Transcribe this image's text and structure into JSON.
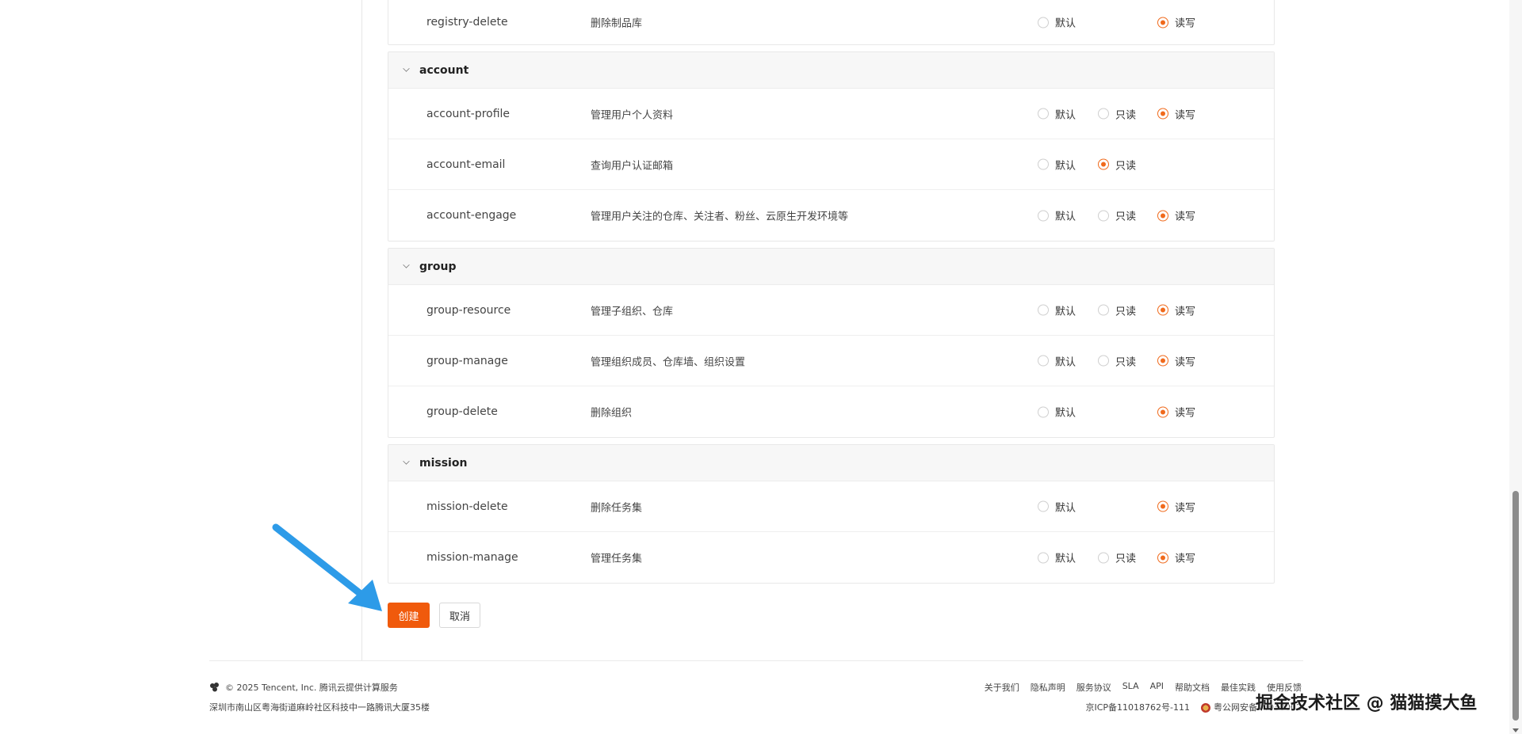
{
  "permission_groups": [
    {
      "name": "",
      "continued": true,
      "rows": [
        {
          "name": "registry-delete",
          "desc": "删除制品库",
          "options": [
            "default",
            "write"
          ],
          "selected": "write"
        }
      ]
    },
    {
      "name": "account",
      "rows": [
        {
          "name": "account-profile",
          "desc": "管理用户个人资料",
          "options": [
            "default",
            "read",
            "write"
          ],
          "selected": "write"
        },
        {
          "name": "account-email",
          "desc": "查询用户认证邮箱",
          "options": [
            "default",
            "read"
          ],
          "selected": "read"
        },
        {
          "name": "account-engage",
          "desc": "管理用户关注的仓库、关注者、粉丝、云原生开发环境等",
          "options": [
            "default",
            "read",
            "write"
          ],
          "selected": "write"
        }
      ]
    },
    {
      "name": "group",
      "rows": [
        {
          "name": "group-resource",
          "desc": "管理子组织、仓库",
          "options": [
            "default",
            "read",
            "write"
          ],
          "selected": "write"
        },
        {
          "name": "group-manage",
          "desc": "管理组织成员、仓库墙、组织设置",
          "options": [
            "default",
            "read",
            "write"
          ],
          "selected": "write"
        },
        {
          "name": "group-delete",
          "desc": "删除组织",
          "options": [
            "default",
            "write"
          ],
          "selected": "write"
        }
      ]
    },
    {
      "name": "mission",
      "rows": [
        {
          "name": "mission-delete",
          "desc": "删除任务集",
          "options": [
            "default",
            "write"
          ],
          "selected": "write"
        },
        {
          "name": "mission-manage",
          "desc": "管理任务集",
          "options": [
            "default",
            "read",
            "write"
          ],
          "selected": "write"
        }
      ]
    }
  ],
  "option_labels": {
    "default": "默认",
    "read": "只读",
    "write": "读写"
  },
  "actions": {
    "create_label": "创建",
    "cancel_label": "取消"
  },
  "footer": {
    "copyright": "© 2025 Tencent, Inc. 腾讯云提供计算服务",
    "address": "深圳市南山区粤海街道麻岭社区科技中一路腾讯大厦35楼",
    "links": [
      "关于我们",
      "隐私声明",
      "服务协议",
      "SLA",
      "API",
      "帮助文档",
      "最佳实践",
      "使用反馈"
    ],
    "icp": "京ICP备11018762号-111",
    "police": "粤公网安备44030002"
  },
  "watermark": "掘金技术社区 @ 猫猫摸大鱼",
  "colors": {
    "accent": "#f05a0c",
    "radio_checked": "#f06a1c",
    "annotation_arrow": "#2d9be8"
  }
}
